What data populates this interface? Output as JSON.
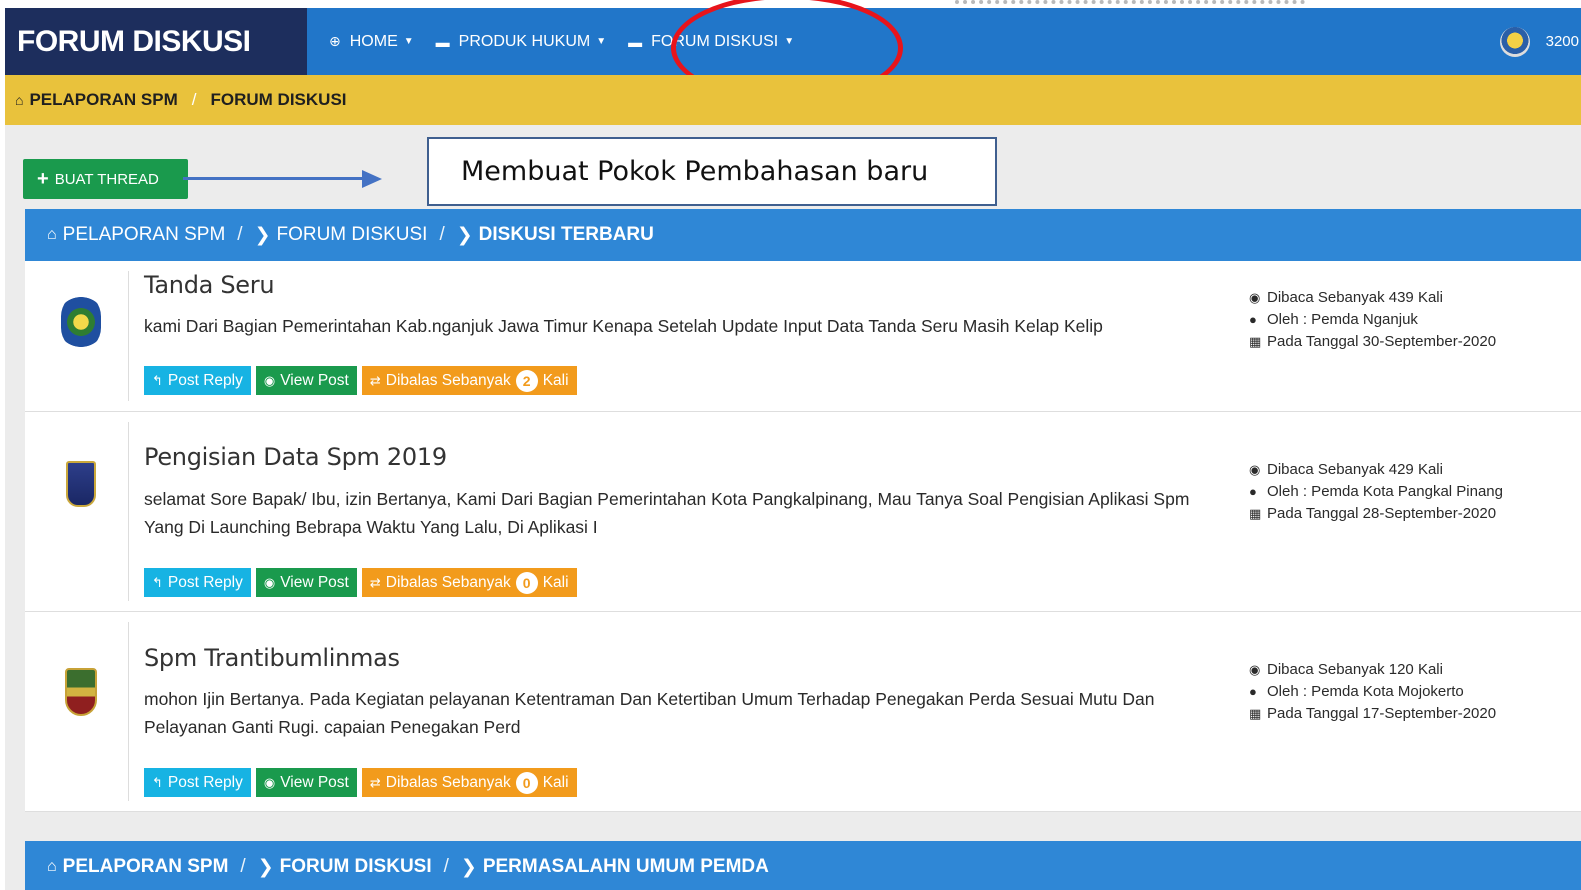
{
  "navbar": {
    "brand": "FORUM DISKUSI",
    "items": [
      {
        "label": "HOME",
        "icon": "globe-icon",
        "glyph": "⊕"
      },
      {
        "label": "PRODUK HUKUM",
        "icon": "list-icon",
        "glyph": "▬"
      },
      {
        "label": "FORUM DISKUSI",
        "icon": "list-icon",
        "glyph": "▬"
      }
    ],
    "user": "3200"
  },
  "top_breadcrumb": [
    "PELAPORAN SPM",
    "FORUM DISKUSI"
  ],
  "new_thread_button": "BUAT THREAD",
  "callout_text": "Membuat Pokok Pembahasan baru",
  "section1": {
    "home": "PELAPORAN SPM",
    "forum": "FORUM DISKUSI",
    "current": "DISKUSI TERBARU"
  },
  "section2": {
    "home": "PELAPORAN SPM",
    "forum": "FORUM DISKUSI",
    "current": "PERMASALAHN UMUM PEMDA"
  },
  "actions": {
    "reply": "Post Reply",
    "view": "View Post",
    "replied_prefix": "Dibalas Sebanyak",
    "replied_suffix": "Kali"
  },
  "threads": [
    {
      "title": "Tanda Seru",
      "description": "kami Dari Bagian Pemerintahan Kab.nganjuk Jawa Timur Kenapa Setelah Update Input Data Tanda Seru Masih Kelap Kelip",
      "replies": "2",
      "views": "Dibaca Sebanyak 439 Kali",
      "author": "Oleh : Pemda Nganjuk",
      "date": "Pada Tanggal 30-September-2020"
    },
    {
      "title": "Pengisian Data Spm 2019",
      "description": "selamat Sore Bapak/ Ibu,  izin Bertanya, Kami Dari Bagian Pemerintahan Kota Pangkalpinang, Mau Tanya Soal Pengisian Aplikasi Spm Yang Di Launching Bebrapa Waktu Yang Lalu, Di Aplikasi I",
      "replies": "0",
      "views": "Dibaca Sebanyak 429 Kali",
      "author": "Oleh : Pemda Kota Pangkal Pinang",
      "date": "Pada Tanggal 28-September-2020"
    },
    {
      "title": "Spm Trantibumlinmas",
      "description": "mohon Ijin Bertanya. Pada Kegiatan pelayanan Ketentraman Dan Ketertiban Umum Terhadap Penegakan Perda Sesuai Mutu Dan Pelayanan Ganti Rugi. capaian Penegakan Perd",
      "replies": "0",
      "views": "Dibaca Sebanyak 120 Kali",
      "author": "Oleh : Pemda Kota Mojokerto",
      "date": "Pada Tanggal 17-September-2020"
    }
  ],
  "colors": {
    "brand_bg": "#1d2e5d",
    "navbar": "#2176c9",
    "crumbbar": "#e9c23c",
    "section": "#2f87d6",
    "reply": "#17b3e3",
    "view": "#1a9a4d",
    "count": "#f29b1c",
    "annotation": "#e8141b"
  }
}
